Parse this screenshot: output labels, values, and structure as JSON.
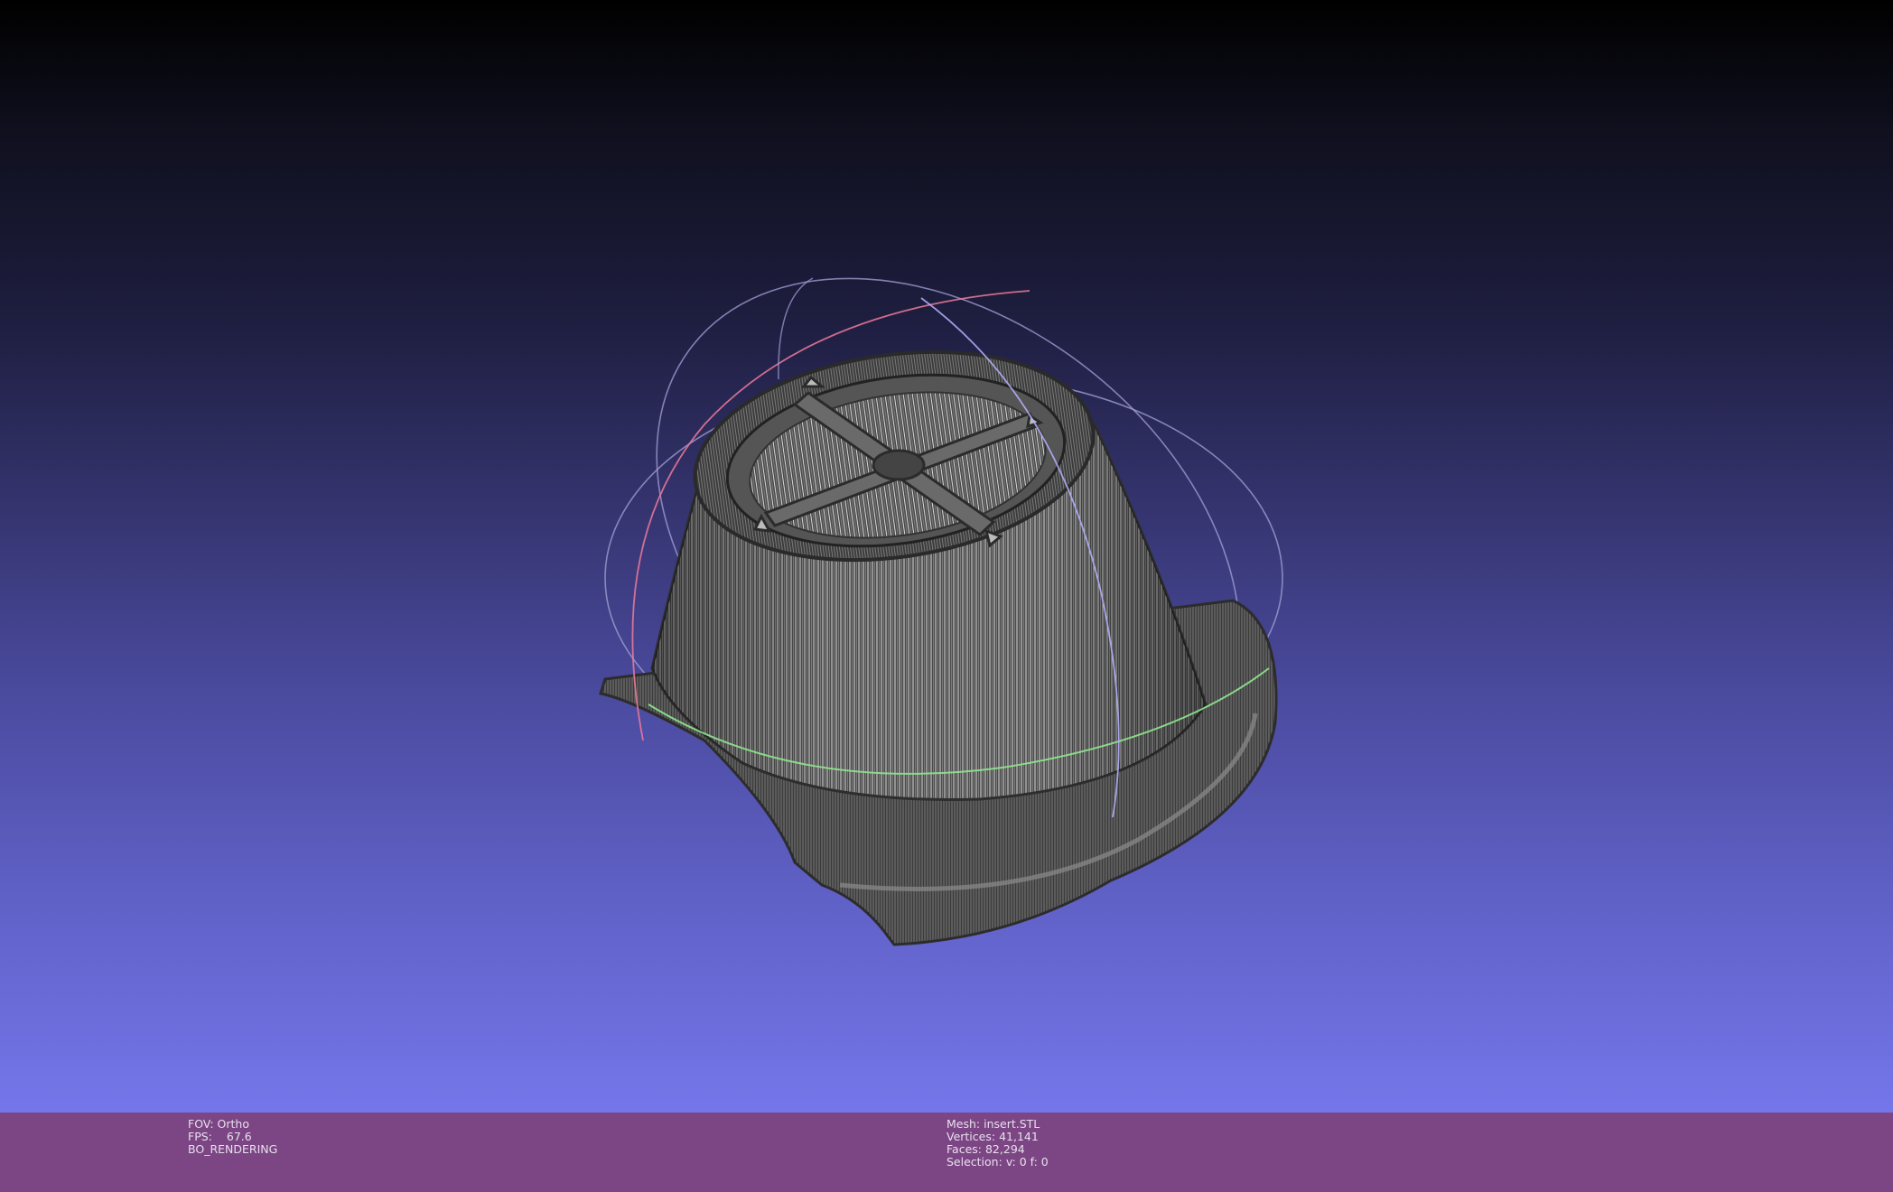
{
  "app": "MeshLab 3D viewer",
  "viewport": {
    "background_top": "#000000",
    "background_bottom": "#7576ea",
    "mesh_color": "#4a4a4a",
    "wire_color": "#d0d0d0",
    "trackball_colors": {
      "x": "#f07a9a",
      "y": "#8fe58f",
      "z": "#b6b2ff"
    }
  },
  "status": {
    "fov_label": "FOV:",
    "fov_value": "Ortho",
    "fps_label": "FPS:",
    "fps_value": "67.6",
    "render_mode": "BO_RENDERING",
    "mesh_label": "Mesh:",
    "mesh_value": "insert.STL",
    "vertices_label": "Vertices:",
    "vertices_value": "41,141",
    "faces_label": "Faces:",
    "faces_value": "82,294",
    "selection_label": "Selection:",
    "selection_value": "v: 0 f: 0"
  },
  "status_bar_color": "#7c4684"
}
